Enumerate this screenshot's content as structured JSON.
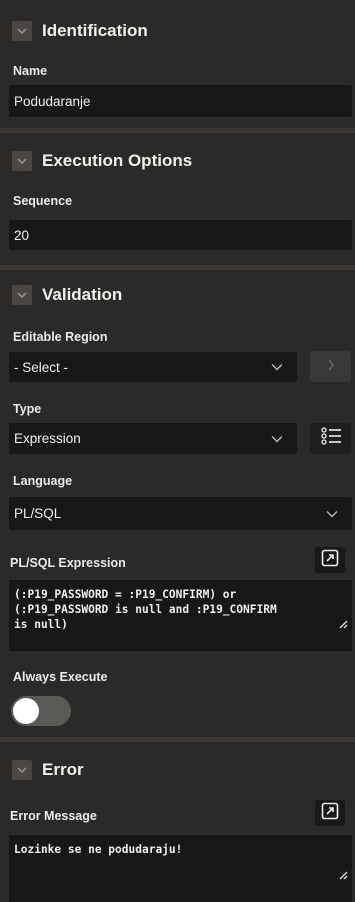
{
  "sections": {
    "identification": {
      "title": "Identification",
      "name_label": "Name",
      "name_value": "Podudaranje"
    },
    "execution": {
      "title": "Execution Options",
      "sequence_label": "Sequence",
      "sequence_value": "20"
    },
    "validation": {
      "title": "Validation",
      "editable_region_label": "Editable Region",
      "editable_region_value": "- Select -",
      "type_label": "Type",
      "type_value": "Expression",
      "language_label": "Language",
      "language_value": "PL/SQL",
      "plsql_label": "PL/SQL Expression",
      "plsql_line1": "(:P19_PASSWORD = :P19_CONFIRM) or",
      "plsql_line2": "(:P19_PASSWORD is null and :P19_CONFIRM",
      "plsql_line3": "is null)",
      "always_execute_label": "Always Execute",
      "always_execute_on": false
    },
    "error": {
      "title": "Error",
      "message_label": "Error Message",
      "message_value": "Lozinke se ne podudaraju!"
    }
  },
  "icons": {
    "collapse": "chevron-down-icon",
    "dropdown": "chevron-down-icon",
    "go": "chevron-right-icon",
    "list": "list-icon",
    "expand": "expand-icon",
    "resize": "resize-handle-icon"
  },
  "colors": {
    "panel": "#2c2a28",
    "field": "#181716",
    "divider": "#3a3735"
  }
}
